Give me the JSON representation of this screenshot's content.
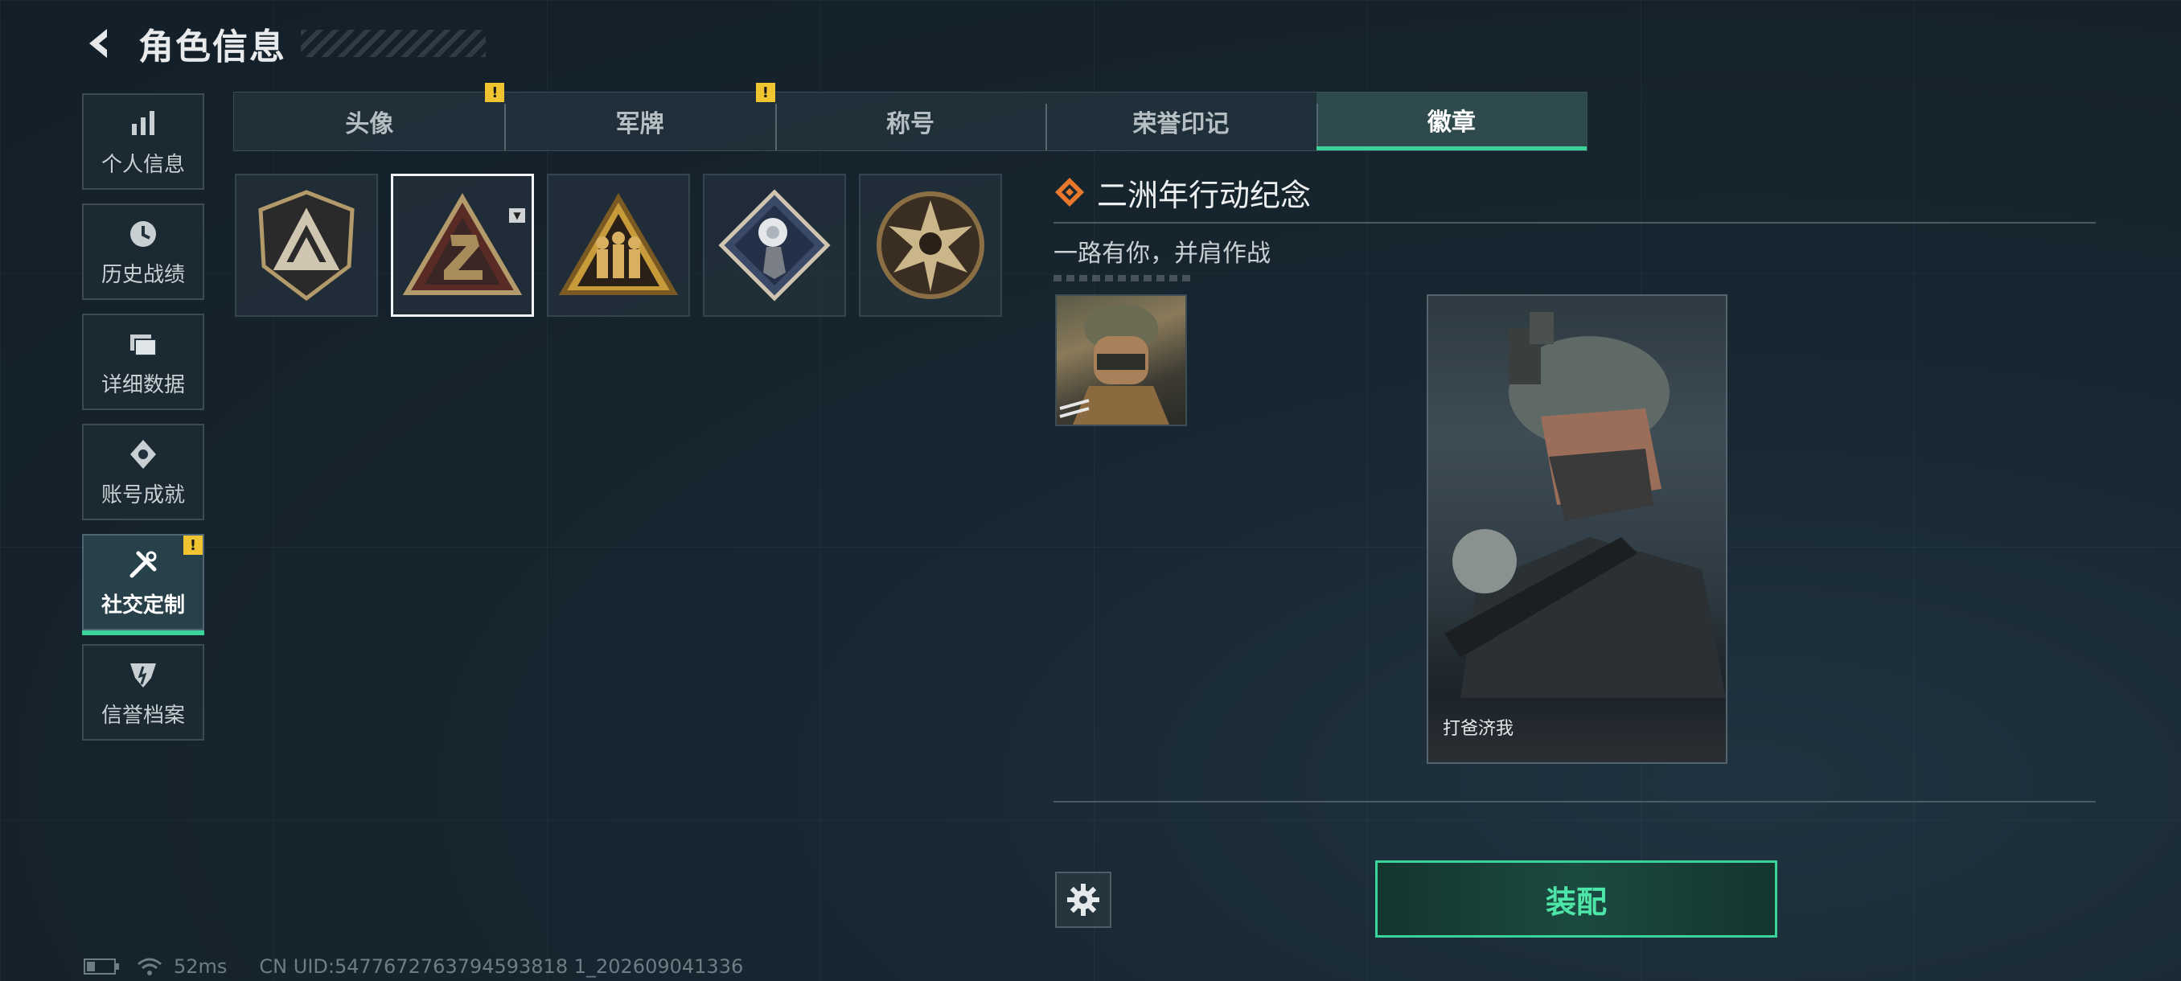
{
  "header": {
    "title": "角色信息"
  },
  "nav": {
    "items": [
      {
        "label": "个人信息",
        "icon": "bar-chart-icon"
      },
      {
        "label": "历史战绩",
        "icon": "clock-icon"
      },
      {
        "label": "详细数据",
        "icon": "folder-icon"
      },
      {
        "label": "账号成就",
        "icon": "achievement-icon"
      },
      {
        "label": "社交定制",
        "icon": "tools-icon",
        "active": true,
        "badge": "!"
      },
      {
        "label": "信誉档案",
        "icon": "shield-icon"
      }
    ]
  },
  "tabs": [
    {
      "label": "头像",
      "badge": "!"
    },
    {
      "label": "军牌",
      "badge": "!"
    },
    {
      "label": "称号"
    },
    {
      "label": "荣誉印记"
    },
    {
      "label": "徽章",
      "active": true
    }
  ],
  "badges": [
    {
      "icon": "shield-triangle-badge-icon"
    },
    {
      "icon": "triangle-2-badge-icon",
      "selected": true
    },
    {
      "icon": "soldiers-triangle-badge-icon"
    },
    {
      "icon": "rose-diamond-badge-icon"
    },
    {
      "icon": "star-skull-badge-icon"
    }
  ],
  "detail": {
    "title": "二洲年行动纪念",
    "description": "一路有你，并肩作战",
    "card_label": "打爸济我"
  },
  "actions": {
    "equip_label": "装配"
  },
  "footer": {
    "ping": "52ms",
    "uid": "CN UID:5477672763794593818 1_202609041336"
  },
  "colors": {
    "accent": "#3ad49a",
    "badge": "#f0c430",
    "icon_orange": "#e8782c"
  }
}
